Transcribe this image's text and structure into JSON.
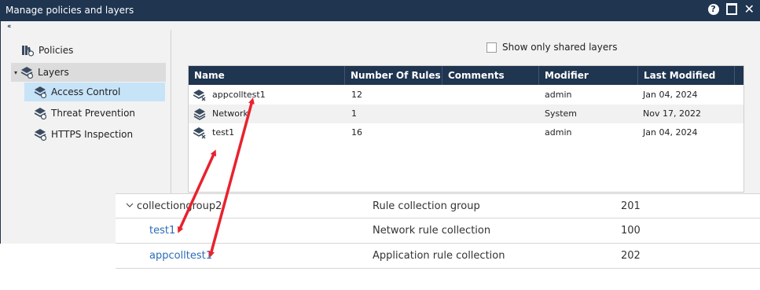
{
  "window": {
    "title": "Manage policies and layers",
    "icons": [
      "help-icon",
      "maximize-icon",
      "close-icon"
    ],
    "help_glyph": "?",
    "close_glyph": "✕"
  },
  "sidebar": {
    "collapse_glyph": "‹‹",
    "expand_glyph": "▾",
    "items": [
      {
        "label": "Policies",
        "icon": "policies-icon"
      },
      {
        "label": "Layers",
        "icon": "layers-icon"
      },
      {
        "label": "Access Control",
        "icon": "access-control-icon"
      },
      {
        "label": "Threat Prevention",
        "icon": "threat-prevention-icon"
      },
      {
        "label": "HTTPS Inspection",
        "icon": "https-inspection-icon"
      }
    ]
  },
  "main": {
    "shared_checkbox_label": "Show only shared layers",
    "columns": [
      "Name",
      "Number Of Rules",
      "Comments",
      "Modifier",
      "Last Modified"
    ],
    "rows": [
      {
        "name": "appcolltest1",
        "rules": "12",
        "comments": "",
        "modifier": "admin",
        "last_modified": "Jan 04, 2024"
      },
      {
        "name": "Network",
        "rules": "1",
        "comments": "",
        "modifier": "System",
        "last_modified": "Nov 17, 2022"
      },
      {
        "name": "test1",
        "rules": "16",
        "comments": "",
        "modifier": "admin",
        "last_modified": "Jan 04, 2024"
      }
    ]
  },
  "overlay": {
    "rows": [
      {
        "name": "collectiongroup2",
        "type": "Rule collection group",
        "priority": "201"
      },
      {
        "name": "test1",
        "type": "Network rule collection",
        "priority": "100"
      },
      {
        "name": "appcolltest1",
        "type": "Application rule collection",
        "priority": "202"
      }
    ]
  },
  "colors": {
    "titlebar": "#1f3550",
    "header": "#1f3550",
    "selected": "#c7e3f8",
    "arrow": "#e8222e",
    "link": "#2b6cb7"
  }
}
